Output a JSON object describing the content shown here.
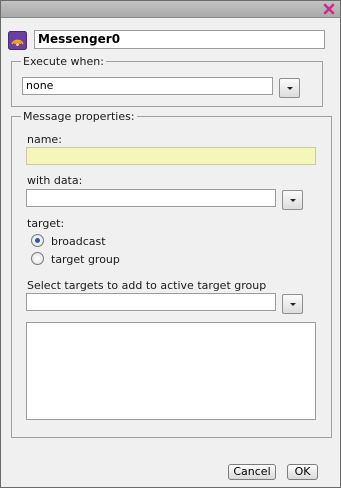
{
  "component": {
    "name": "Messenger0",
    "icon": "messenger-broadcast-icon"
  },
  "titlebar": {
    "close_icon": "close-icon",
    "close_color": "#cc2a8a"
  },
  "execute_when": {
    "legend": "Execute when:",
    "value": "none"
  },
  "message_properties": {
    "legend": "Message properties:",
    "name_label": "name:",
    "name_value": "",
    "with_data_label": "with data:",
    "with_data_value": "",
    "target_label": "target:",
    "target_options": [
      {
        "label": "broadcast",
        "selected": true
      },
      {
        "label": "target group",
        "selected": false
      }
    ],
    "select_targets_label": "Select targets to add to active target group",
    "select_targets_value": "",
    "targets_list": []
  },
  "footer": {
    "cancel_label": "Cancel",
    "ok_label": "OK"
  },
  "colors": {
    "highlight_field": "#f4f7b9",
    "radio_dot": "#2b57a8"
  }
}
